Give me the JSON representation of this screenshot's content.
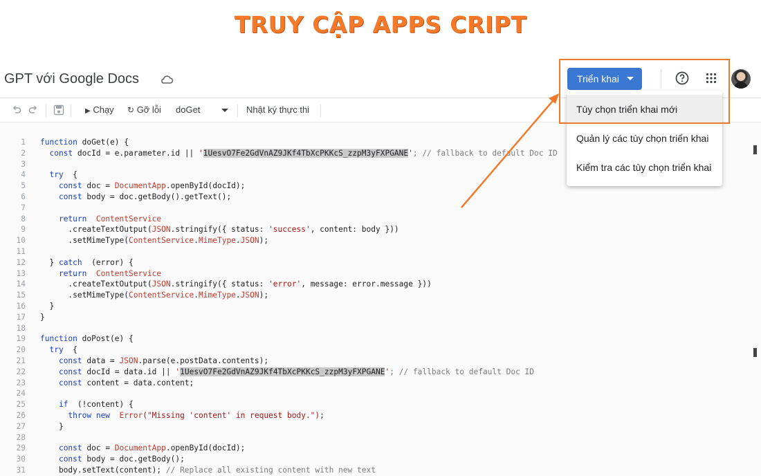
{
  "banner": {
    "text": "TRUY CẬP APPS CRIPT",
    "color": "#f47a2a"
  },
  "header": {
    "title": "GPT với Google Docs",
    "deploy_label": "Triển khai",
    "icons": [
      "cloud-icon",
      "help-icon",
      "apps-grid-icon",
      "avatar"
    ]
  },
  "toolbar": {
    "run_label": "Chạy",
    "debug_label": "Gỡ lỗi",
    "function_select": "doGet",
    "log_label": "Nhật ký thực thi",
    "icons": [
      "undo-icon",
      "redo-icon",
      "save-icon",
      "play-icon",
      "debug-icon",
      "chevron-down-icon"
    ]
  },
  "deploy_menu": {
    "items": [
      {
        "label": "Tùy chọn triển khai mới"
      },
      {
        "label": "Quản lý các tùy chọn triển khai"
      },
      {
        "label": "Kiểm tra các tùy chọn triển khai"
      }
    ],
    "active_index": 0
  },
  "colors": {
    "accent": "#3b78d4",
    "annotation": "#f07a2c",
    "keyword": "#1a3fbf",
    "type": "#c0392b",
    "string": "#a31515"
  },
  "code": {
    "lines": [
      {
        "n": "1",
        "segs": [
          [
            "k",
            "function"
          ],
          [
            "",
            "doGet(e) {"
          ]
        ]
      },
      {
        "n": "2",
        "segs": [
          [
            "",
            "  "
          ],
          [
            "k",
            "const"
          ],
          [
            "",
            "docId = e.parameter.id || "
          ],
          [
            "s",
            "'"
          ],
          [
            "hl",
            "1UesvO7Fe2GdVnAZ9JKf4TbXcPKKcS_zzpM3yFXPGANE"
          ],
          [
            "s",
            "'"
          ],
          [
            "p",
            "; // fallback to default Doc ID"
          ]
        ]
      },
      {
        "n": "3",
        "segs": []
      },
      {
        "n": "4",
        "segs": [
          [
            "",
            "  "
          ],
          [
            "k",
            "try"
          ],
          [
            "",
            " {"
          ]
        ]
      },
      {
        "n": "5",
        "segs": [
          [
            "",
            "    "
          ],
          [
            "k",
            "const"
          ],
          [
            "",
            "doc = "
          ],
          [
            "t",
            "DocumentApp"
          ],
          [
            "",
            ".openById(docId);"
          ]
        ]
      },
      {
        "n": "6",
        "segs": [
          [
            "",
            "    "
          ],
          [
            "k",
            "const"
          ],
          [
            "",
            "body = doc.getBody().getText();"
          ]
        ]
      },
      {
        "n": "7",
        "segs": []
      },
      {
        "n": "8",
        "segs": [
          [
            "",
            "    "
          ],
          [
            "k",
            "return"
          ],
          [
            " t",
            "ContentService"
          ]
        ]
      },
      {
        "n": "9",
        "segs": [
          [
            "",
            "      .createTextOutput("
          ],
          [
            "t",
            "JSON"
          ],
          [
            "",
            ".stringify({ status: "
          ],
          [
            "s",
            "'success'"
          ],
          [
            "",
            ", content: body }))"
          ]
        ]
      },
      {
        "n": "10",
        "segs": [
          [
            "",
            "      .setMimeType("
          ],
          [
            "t",
            "ContentService"
          ],
          [
            "",
            "."
          ],
          [
            "t",
            "MimeType"
          ],
          [
            "",
            "."
          ],
          [
            "t",
            "JSON"
          ],
          [
            "",
            ");"
          ]
        ]
      },
      {
        "n": "11",
        "segs": []
      },
      {
        "n": "12",
        "segs": [
          [
            "",
            "  } "
          ],
          [
            "k",
            "catch"
          ],
          [
            "",
            " (error) {"
          ]
        ]
      },
      {
        "n": "13",
        "segs": [
          [
            "",
            "    "
          ],
          [
            "k",
            "return"
          ],
          [
            " t",
            "ContentService"
          ]
        ]
      },
      {
        "n": "14",
        "segs": [
          [
            "",
            "      .createTextOutput("
          ],
          [
            "t",
            "JSON"
          ],
          [
            "",
            ".stringify({ status: "
          ],
          [
            "s",
            "'error'"
          ],
          [
            "",
            ", message: error.message }))"
          ]
        ]
      },
      {
        "n": "15",
        "segs": [
          [
            "",
            "      .setMimeType("
          ],
          [
            "t",
            "ContentService"
          ],
          [
            "",
            "."
          ],
          [
            "t",
            "MimeType"
          ],
          [
            "",
            "."
          ],
          [
            "t",
            "JSON"
          ],
          [
            "",
            ");"
          ]
        ]
      },
      {
        "n": "16",
        "segs": [
          [
            "",
            "  }"
          ]
        ]
      },
      {
        "n": "17",
        "segs": [
          [
            "",
            "}"
          ]
        ]
      },
      {
        "n": "18",
        "segs": []
      },
      {
        "n": "19",
        "segs": [
          [
            "k",
            "function"
          ],
          [
            "",
            "doPost(e) {"
          ]
        ]
      },
      {
        "n": "20",
        "segs": [
          [
            "",
            "  "
          ],
          [
            "k",
            "try"
          ],
          [
            "",
            " {"
          ]
        ]
      },
      {
        "n": "21",
        "segs": [
          [
            "",
            "    "
          ],
          [
            "k",
            "const"
          ],
          [
            "",
            "data = "
          ],
          [
            "t",
            "JSON"
          ],
          [
            "",
            ".parse(e.postData.contents);"
          ]
        ]
      },
      {
        "n": "22",
        "segs": [
          [
            "",
            "    "
          ],
          [
            "k",
            "const"
          ],
          [
            "",
            "docId = data.id || "
          ],
          [
            "s",
            "'"
          ],
          [
            "hl",
            "1UesvO7Fe2GdVnAZ9JKf4TbXcPKKcS_zzpM3yFXPGANE"
          ],
          [
            "s",
            "'"
          ],
          [
            "p",
            "; // fallback to default Doc ID"
          ]
        ]
      },
      {
        "n": "23",
        "segs": [
          [
            "",
            "    "
          ],
          [
            "k",
            "const"
          ],
          [
            "",
            "content = data.content;"
          ]
        ]
      },
      {
        "n": "24",
        "segs": []
      },
      {
        "n": "25",
        "segs": [
          [
            "",
            "    "
          ],
          [
            "k",
            "if"
          ],
          [
            "",
            " (!content) {"
          ]
        ]
      },
      {
        "n": "26",
        "segs": [
          [
            "",
            "      "
          ],
          [
            "k",
            "throw new"
          ],
          [
            " t",
            "Error"
          ],
          [
            "s",
            "(\"Missing 'content' in request body.\")"
          ],
          [
            "",
            ";"
          ]
        ]
      },
      {
        "n": "27",
        "segs": [
          [
            "",
            "    }"
          ]
        ]
      },
      {
        "n": "28",
        "segs": []
      },
      {
        "n": "29",
        "segs": [
          [
            "",
            "    "
          ],
          [
            "k",
            "const"
          ],
          [
            "",
            "doc = "
          ],
          [
            "t",
            "DocumentApp"
          ],
          [
            "",
            ".openById(docId);"
          ]
        ]
      },
      {
        "n": "30",
        "segs": [
          [
            "",
            "    "
          ],
          [
            "k",
            "const"
          ],
          [
            "",
            "body = doc.getBody();"
          ]
        ]
      },
      {
        "n": "31",
        "segs": [
          [
            "",
            "    body.setText(content); "
          ],
          [
            "p",
            "// Replace all existing content with new text"
          ]
        ]
      }
    ]
  }
}
